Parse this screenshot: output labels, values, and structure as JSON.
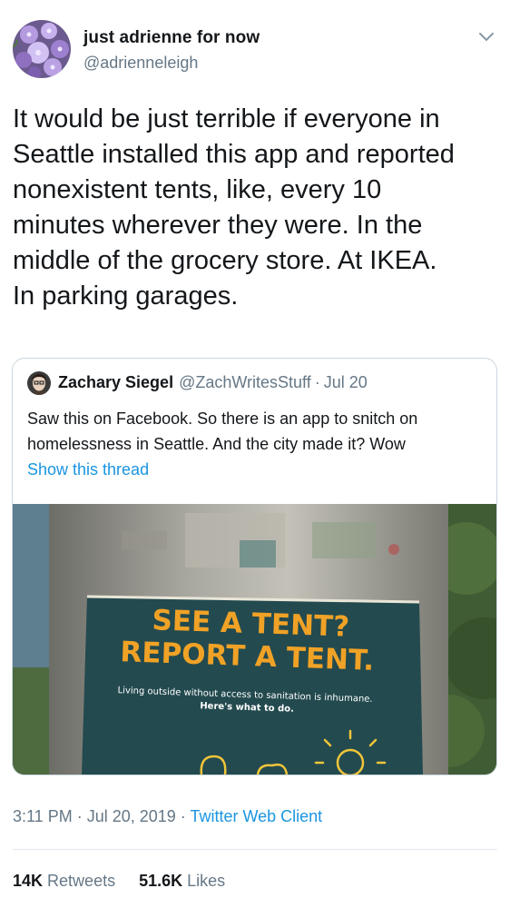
{
  "tweet": {
    "author": {
      "name": "just adrienne for now",
      "handle": "@adrienneleigh"
    },
    "text_lines": [
      "It would be just terrible if everyone in",
      "Seattle installed this app and reported",
      "nonexistent tents, like, every 10",
      "minutes wherever they were. In the",
      "middle of the grocery store. At IKEA.",
      "In parking garages."
    ],
    "quoted": {
      "name": "Zachary Siegel",
      "handle": "@ZachWritesStuff",
      "separator": "·",
      "date": "Jul 20",
      "text_lines": [
        "Saw this on Facebook. So there is an app to snitch on",
        "homelessness in Seattle. And the city made it? Wow"
      ],
      "show_thread": "Show this thread",
      "image": {
        "sign_line1": "SEE A TENT?",
        "sign_line2": "REPORT A TENT.",
        "sign_small1": "Living outside without access to sanitation is inhumane.",
        "sign_small2": "Here's what to do."
      }
    },
    "timestamp": {
      "time_date": "3:11 PM · Jul 20, 2019 · ",
      "client": "Twitter Web Client"
    },
    "stats": {
      "retweets_count": "14K",
      "retweets_label": "Retweets",
      "likes_count": "51.6K",
      "likes_label": "Likes"
    }
  },
  "colors": {
    "text": "#14171a",
    "secondary": "#657786",
    "link": "#1b95e0",
    "border": "#ccd6dd",
    "sign_text": "#f0a226",
    "sign_panel": "#234a4f"
  },
  "icons": {
    "caret": "chevron-down-icon",
    "avatar": "flower-avatar",
    "quoted_avatar": "person-avatar"
  }
}
